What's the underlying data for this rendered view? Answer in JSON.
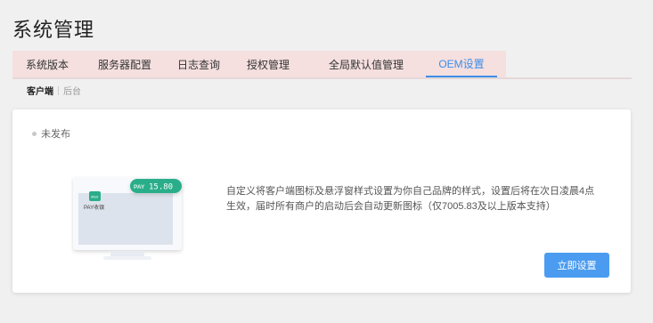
{
  "page": {
    "title": "系统管理"
  },
  "tabs": [
    {
      "label": "系统版本"
    },
    {
      "label": "服务器配置"
    },
    {
      "label": "日志查询"
    },
    {
      "label": "授权管理"
    },
    {
      "label": "全局默认值管理"
    },
    {
      "label": "OEM设置",
      "active": true
    }
  ],
  "subtabs": [
    {
      "label": "客户端",
      "active": true
    },
    {
      "label": "后台"
    }
  ],
  "card": {
    "status": "未发布",
    "description": "自定义将客户端图标及悬浮窗样式设置为你自己品牌的样式，设置后将在次日凌晨4点生效，届时所有商户的启动后会自动更新图标（仅7005.83及以上版本支持）",
    "button_label": "立即设置",
    "illustration": {
      "pay_badge": "PAY",
      "pay_amount": "15.80",
      "app_icon_text": "PAY",
      "app_label": "PAY收银"
    }
  },
  "colors": {
    "accent": "#3c8ee8",
    "button": "#4b9cf0",
    "tabbar_bg": "#f5dfdf",
    "badge_green": "#2aae8a"
  }
}
